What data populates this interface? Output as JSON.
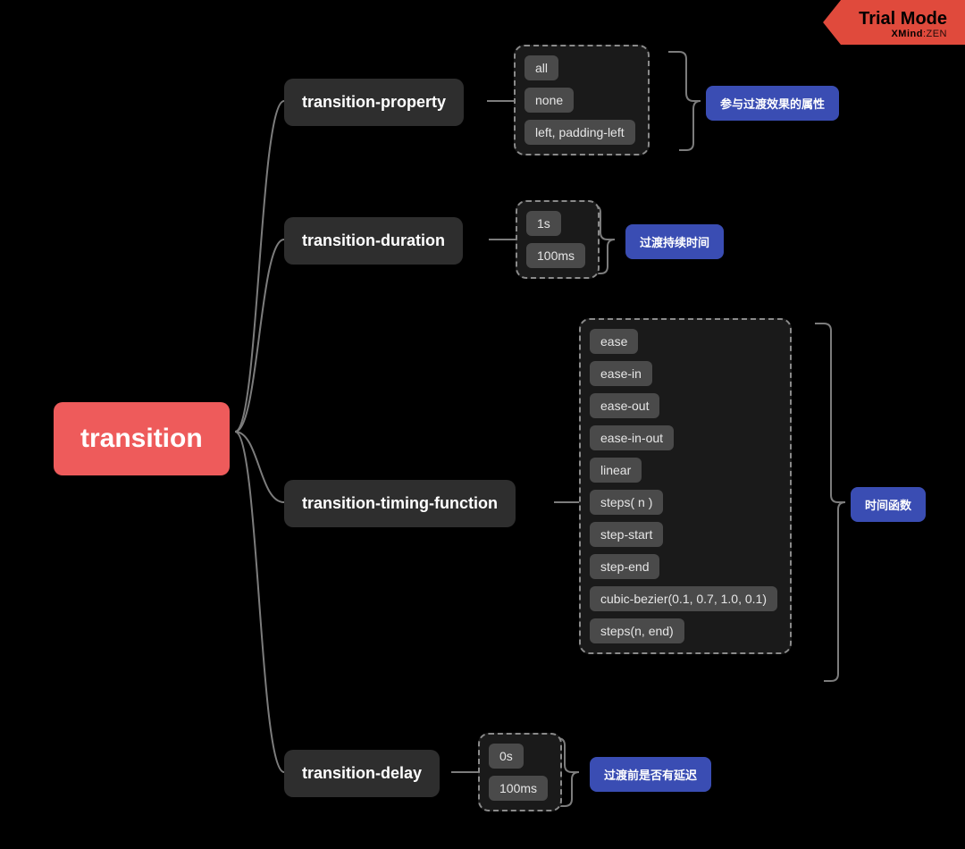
{
  "badge": {
    "title": "Trial Mode",
    "sub_bold": "XMind",
    "sub_thin": ":ZEN"
  },
  "root": {
    "label": "transition"
  },
  "props": {
    "property": {
      "label": "transition-property",
      "values": [
        "all",
        "none",
        "left, padding-left"
      ],
      "annot": "参与过渡效果的属性"
    },
    "duration": {
      "label": "transition-duration",
      "values": [
        "1s",
        "100ms"
      ],
      "annot": "过渡持续时间"
    },
    "timing": {
      "label": "transition-timing-function",
      "values": [
        "ease",
        "ease-in",
        "ease-out",
        "ease-in-out",
        "linear",
        "steps( n )",
        "step-start",
        "step-end",
        "cubic-bezier(0.1, 0.7, 1.0, 0.1)",
        "steps(n, end)"
      ],
      "annot": "时间函数"
    },
    "delay": {
      "label": "transition-delay",
      "values": [
        "0s",
        "100ms"
      ],
      "annot": "过渡前是否有延迟"
    }
  }
}
